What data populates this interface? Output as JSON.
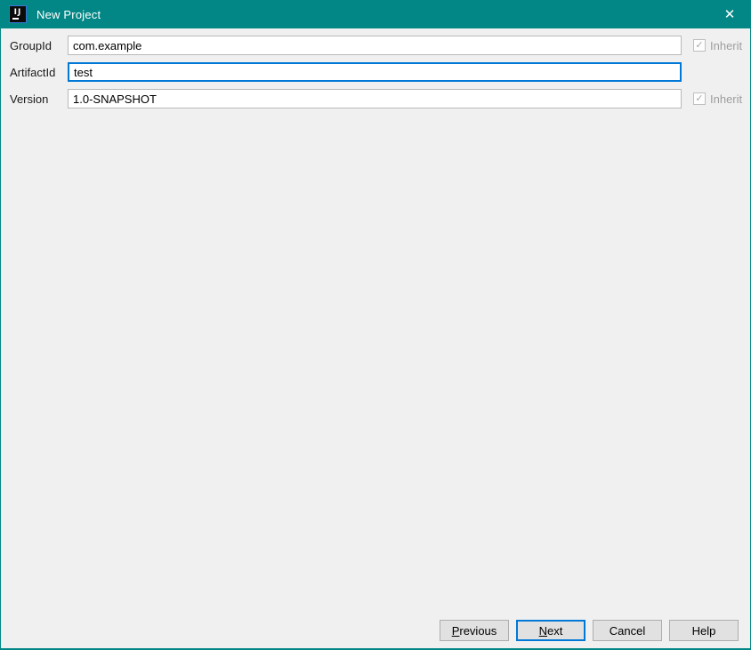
{
  "titlebar": {
    "title": "New Project",
    "app_icon_text": "IJ",
    "close_glyph": "✕"
  },
  "form": {
    "rows": [
      {
        "label": "GroupId",
        "value": "com.example",
        "inherit_label": "Inherit",
        "checkbox_glyph": "✓",
        "inherit_checked": true
      },
      {
        "label": "ArtifactId",
        "value": "test"
      },
      {
        "label": "Version",
        "value": "1.0-SNAPSHOT",
        "inherit_label": "Inherit",
        "checkbox_glyph": "✓",
        "inherit_checked": true
      }
    ]
  },
  "footer": {
    "previous": {
      "mnemonic": "P",
      "rest": "revious"
    },
    "next": {
      "mnemonic": "N",
      "rest": "ext"
    },
    "cancel": {
      "label": "Cancel"
    },
    "help": {
      "label": "Help"
    }
  },
  "colors": {
    "titlebar_teal": "#038786",
    "focus_blue": "#0078d7",
    "content_background": "#f0f0f0",
    "button_background": "#e1e1e1",
    "disabled_text": "#9e9e9e"
  }
}
